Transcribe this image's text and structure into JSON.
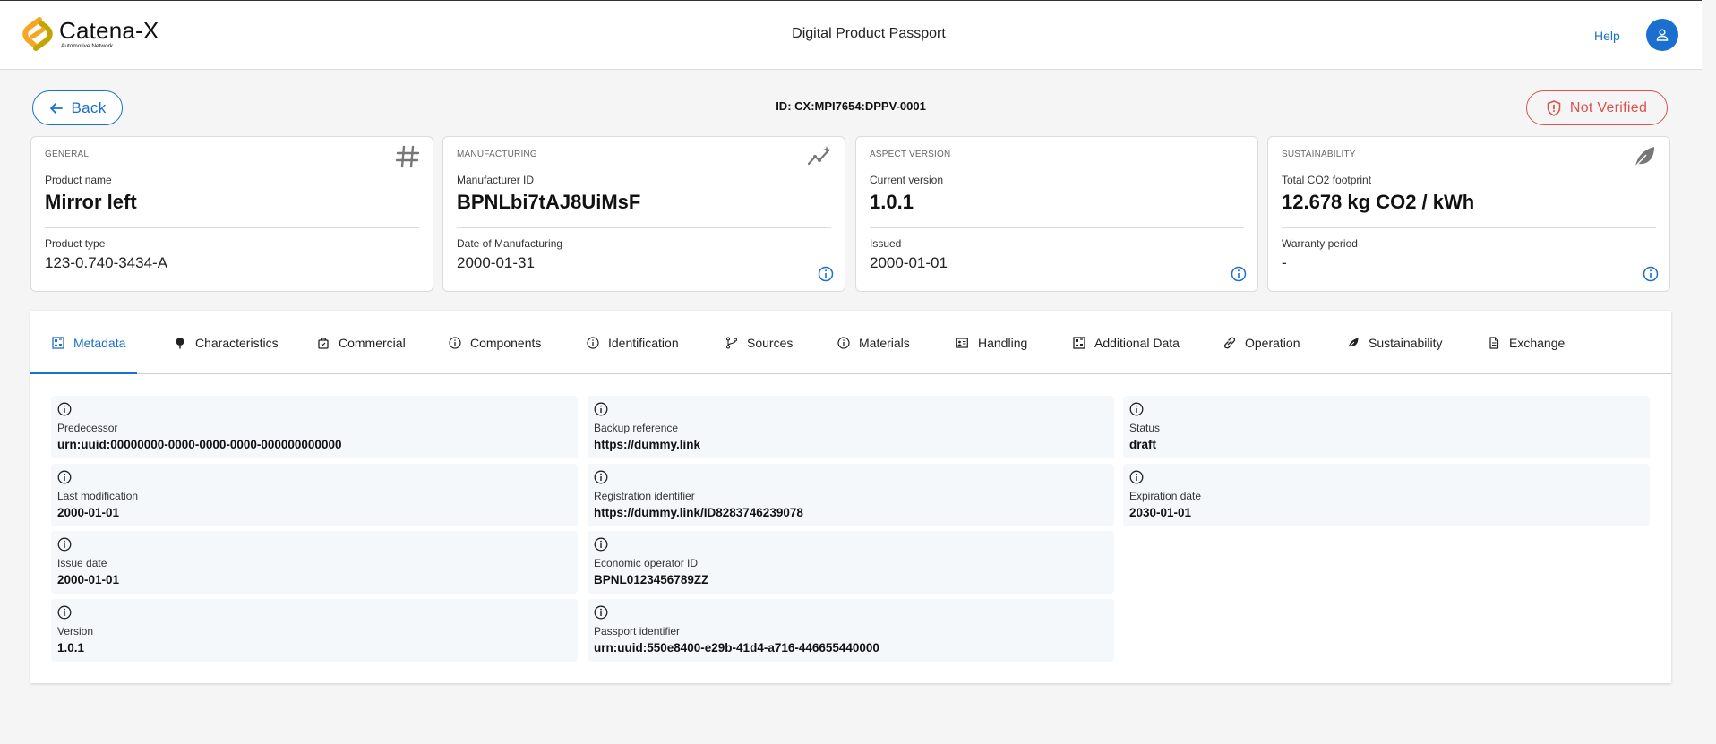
{
  "header": {
    "logo_title": "Catena-X",
    "logo_subtitle": "Automotive Network",
    "title": "Digital Product Passport",
    "help_label": "Help"
  },
  "toolbar": {
    "back_label": "Back",
    "id_text": "ID: CX:MPI7654:DPPV-0001",
    "verification_status": "Not Verified"
  },
  "cards": [
    {
      "category": "GENERAL",
      "icon": "hash-icon",
      "label1": "Product name",
      "value1": "Mirror left",
      "label2": "Product type",
      "value2": "123-0.740-3434-A"
    },
    {
      "category": "MANUFACTURING",
      "icon": "trend-icon",
      "label1": "Manufacturer ID",
      "value1": "BPNLbi7tAJ8UiMsF",
      "label2": "Date of Manufacturing",
      "value2": "2000-01-31"
    },
    {
      "category": "ASPECT VERSION",
      "icon": "",
      "label1": "Current version",
      "value1": "1.0.1",
      "label2": "Issued",
      "value2": "2000-01-01"
    },
    {
      "category": "SUSTAINABILITY",
      "icon": "leaf-icon",
      "label1": "Total CO2 footprint",
      "value1": "12.678 kg CO2 / kWh",
      "label2": "Warranty period",
      "value2": "-"
    }
  ],
  "tabs": [
    {
      "label": "Metadata",
      "icon": "grid-icon",
      "active": true
    },
    {
      "label": "Characteristics",
      "icon": "pin-icon"
    },
    {
      "label": "Commercial",
      "icon": "bag-icon"
    },
    {
      "label": "Components",
      "icon": "info-icon"
    },
    {
      "label": "Identification",
      "icon": "info-icon"
    },
    {
      "label": "Sources",
      "icon": "branch-icon"
    },
    {
      "label": "Materials",
      "icon": "info-icon"
    },
    {
      "label": "Handling",
      "icon": "id-card-icon"
    },
    {
      "label": "Additional Data",
      "icon": "grid-icon"
    },
    {
      "label": "Operation",
      "icon": "link-icon"
    },
    {
      "label": "Sustainability",
      "icon": "leaf-icon"
    },
    {
      "label": "Exchange",
      "icon": "document-icon"
    }
  ],
  "metadata_fields": [
    {
      "label": "Predecessor",
      "value": "urn:uuid:00000000-0000-0000-0000-000000000000"
    },
    {
      "label": "Backup reference",
      "value": "https://dummy.link"
    },
    {
      "label": "Status",
      "value": "draft"
    },
    {
      "label": "Last modification",
      "value": "2000-01-01"
    },
    {
      "label": "Registration identifier",
      "value": "https://dummy.link/ID8283746239078"
    },
    {
      "label": "Expiration date",
      "value": "2030-01-01"
    },
    {
      "label": "Issue date",
      "value": "2000-01-01"
    },
    {
      "label": "Economic operator ID",
      "value": "BPNL0123456789ZZ"
    },
    {
      "label": "Version",
      "value": "1.0.1"
    },
    {
      "label": "Passport identifier",
      "value": "urn:uuid:550e8400-e29b-41d4-a716-446655440000"
    }
  ],
  "colors": {
    "primary": "#1a6fcf",
    "danger": "#d9534f",
    "field_bg": "#f4f8fb"
  }
}
